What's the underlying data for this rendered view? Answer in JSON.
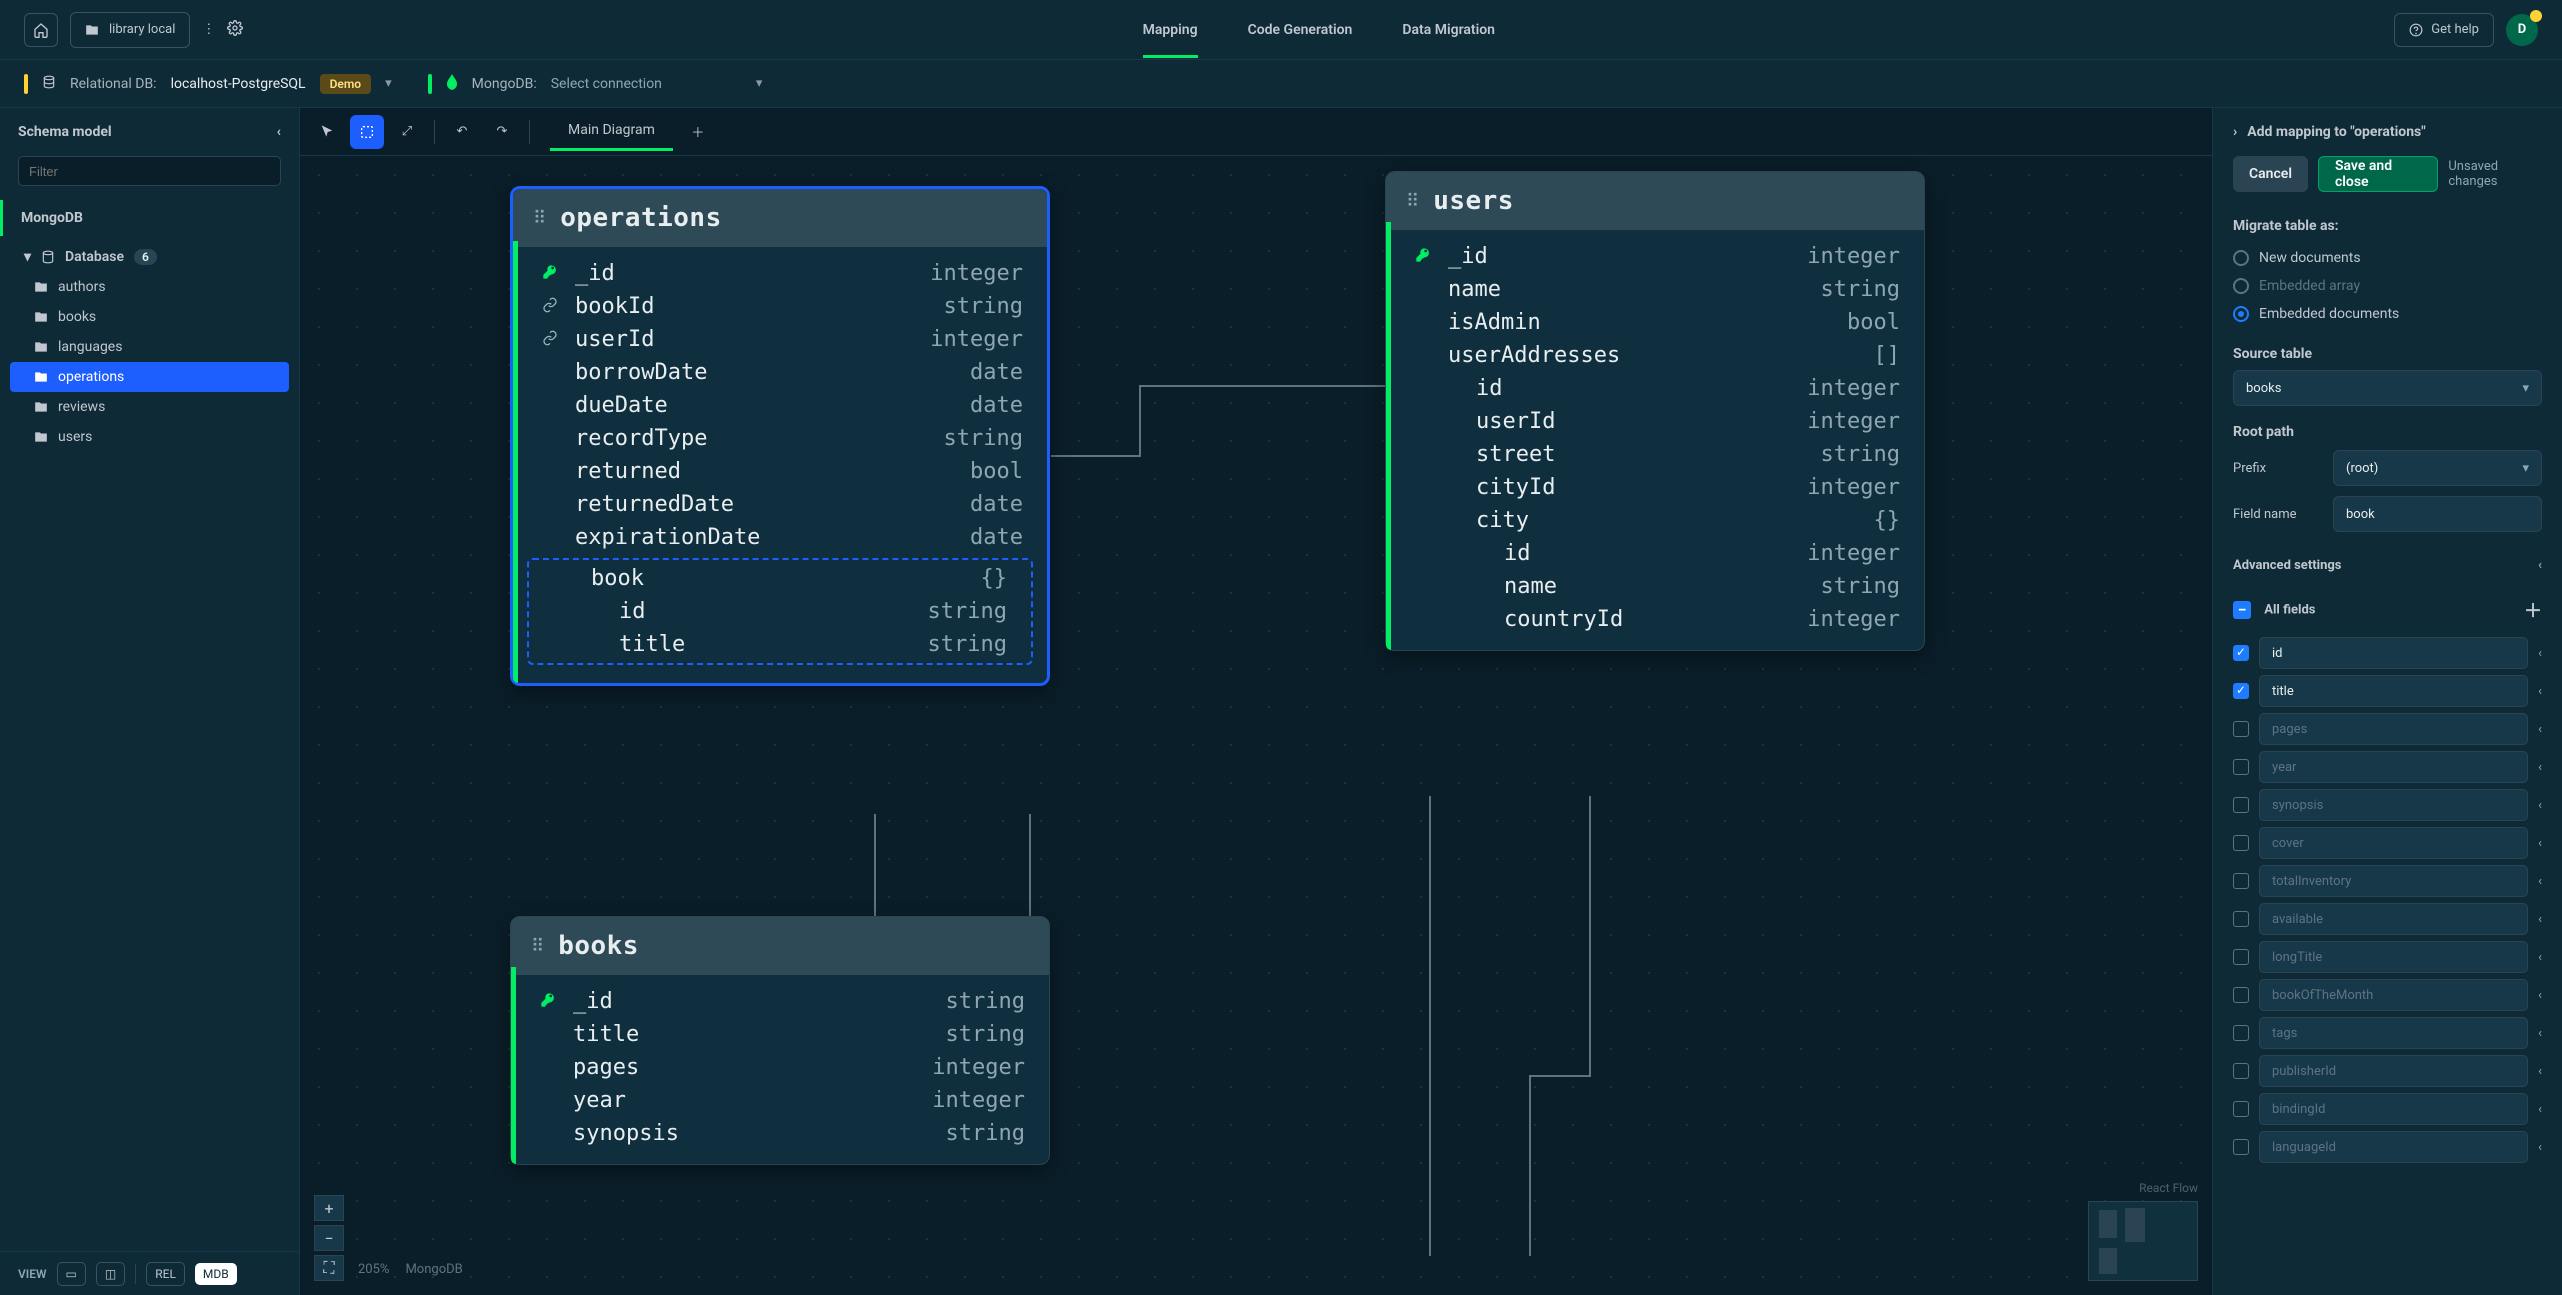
{
  "topbar": {
    "project": "library local",
    "tabs": [
      "Mapping",
      "Code Generation",
      "Data Migration"
    ],
    "active_tab": "Mapping",
    "help": "Get help",
    "avatar_initial": "D"
  },
  "connections": {
    "rel_label": "Relational DB:",
    "rel_value": "localhost-PostgreSQL",
    "demo_chip": "Demo",
    "mongo_label": "MongoDB:",
    "mongo_value": "Select connection"
  },
  "schema": {
    "title": "Schema model",
    "filter_placeholder": "Filter",
    "datasource": "MongoDB",
    "db_label": "Database",
    "db_count": "6",
    "collections": [
      "authors",
      "books",
      "languages",
      "operations",
      "reviews",
      "users"
    ],
    "selected": "operations",
    "viewbar": {
      "label": "VIEW",
      "rel": "REL",
      "mdb": "MDB"
    }
  },
  "canvas": {
    "tab": "Main Diagram",
    "zoom": "205%",
    "engine": "MongoDB",
    "attribution": "React Flow"
  },
  "entities": {
    "operations": {
      "title": "operations",
      "rows": [
        {
          "icon": "key",
          "name": "_id",
          "type": "integer"
        },
        {
          "icon": "link",
          "name": "bookId",
          "type": "string"
        },
        {
          "icon": "link",
          "name": "userId",
          "type": "integer"
        },
        {
          "icon": "",
          "name": "borrowDate",
          "type": "date"
        },
        {
          "icon": "",
          "name": "dueDate",
          "type": "date"
        },
        {
          "icon": "",
          "name": "recordType",
          "type": "string"
        },
        {
          "icon": "",
          "name": "returned",
          "type": "bool"
        },
        {
          "icon": "",
          "name": "returnedDate",
          "type": "date"
        },
        {
          "icon": "",
          "name": "expirationDate",
          "type": "date"
        }
      ],
      "embedded": {
        "name": "book",
        "type": "{}",
        "children": [
          {
            "name": "id",
            "type": "string"
          },
          {
            "name": "title",
            "type": "string"
          }
        ]
      }
    },
    "users": {
      "title": "users",
      "rows": [
        {
          "icon": "key",
          "name": "_id",
          "type": "integer"
        },
        {
          "icon": "",
          "name": "name",
          "type": "string"
        },
        {
          "icon": "",
          "name": "isAdmin",
          "type": "bool"
        },
        {
          "icon": "",
          "name": "userAddresses",
          "type": "[]"
        },
        {
          "icon": "",
          "name": "id",
          "type": "integer",
          "indent": 1
        },
        {
          "icon": "",
          "name": "userId",
          "type": "integer",
          "indent": 1
        },
        {
          "icon": "",
          "name": "street",
          "type": "string",
          "indent": 1
        },
        {
          "icon": "",
          "name": "cityId",
          "type": "integer",
          "indent": 1
        },
        {
          "icon": "",
          "name": "city",
          "type": "{}",
          "indent": 1
        },
        {
          "icon": "",
          "name": "id",
          "type": "integer",
          "indent": 2
        },
        {
          "icon": "",
          "name": "name",
          "type": "string",
          "indent": 2
        },
        {
          "icon": "",
          "name": "countryId",
          "type": "integer",
          "indent": 2
        }
      ]
    },
    "books": {
      "title": "books",
      "rows": [
        {
          "icon": "key",
          "name": "_id",
          "type": "string"
        },
        {
          "icon": "",
          "name": "title",
          "type": "string"
        },
        {
          "icon": "",
          "name": "pages",
          "type": "integer"
        },
        {
          "icon": "",
          "name": "year",
          "type": "integer"
        },
        {
          "icon": "",
          "name": "synopsis",
          "type": "string"
        }
      ]
    }
  },
  "rpanel": {
    "header": "Add mapping to \"operations\"",
    "cancel": "Cancel",
    "save": "Save and close",
    "unsaved": "Unsaved changes",
    "migrate_label": "Migrate table as:",
    "migrate_options": [
      {
        "label": "New documents",
        "checked": false,
        "disabled": false
      },
      {
        "label": "Embedded array",
        "checked": false,
        "disabled": true
      },
      {
        "label": "Embedded documents",
        "checked": true,
        "disabled": false
      }
    ],
    "source_label": "Source table",
    "source_value": "books",
    "rootpath_label": "Root path",
    "prefix_label": "Prefix",
    "prefix_value": "(root)",
    "fieldname_label": "Field name",
    "fieldname_value": "book",
    "advanced": "Advanced settings",
    "allfields": "All fields",
    "fields": [
      {
        "name": "id",
        "on": true
      },
      {
        "name": "title",
        "on": true
      },
      {
        "name": "pages",
        "on": false
      },
      {
        "name": "year",
        "on": false
      },
      {
        "name": "synopsis",
        "on": false
      },
      {
        "name": "cover",
        "on": false
      },
      {
        "name": "totalInventory",
        "on": false
      },
      {
        "name": "available",
        "on": false
      },
      {
        "name": "longTitle",
        "on": false
      },
      {
        "name": "bookOfTheMonth",
        "on": false
      },
      {
        "name": "tags",
        "on": false
      },
      {
        "name": "publisherId",
        "on": false
      },
      {
        "name": "bindingId",
        "on": false
      },
      {
        "name": "languageId",
        "on": false
      }
    ]
  }
}
